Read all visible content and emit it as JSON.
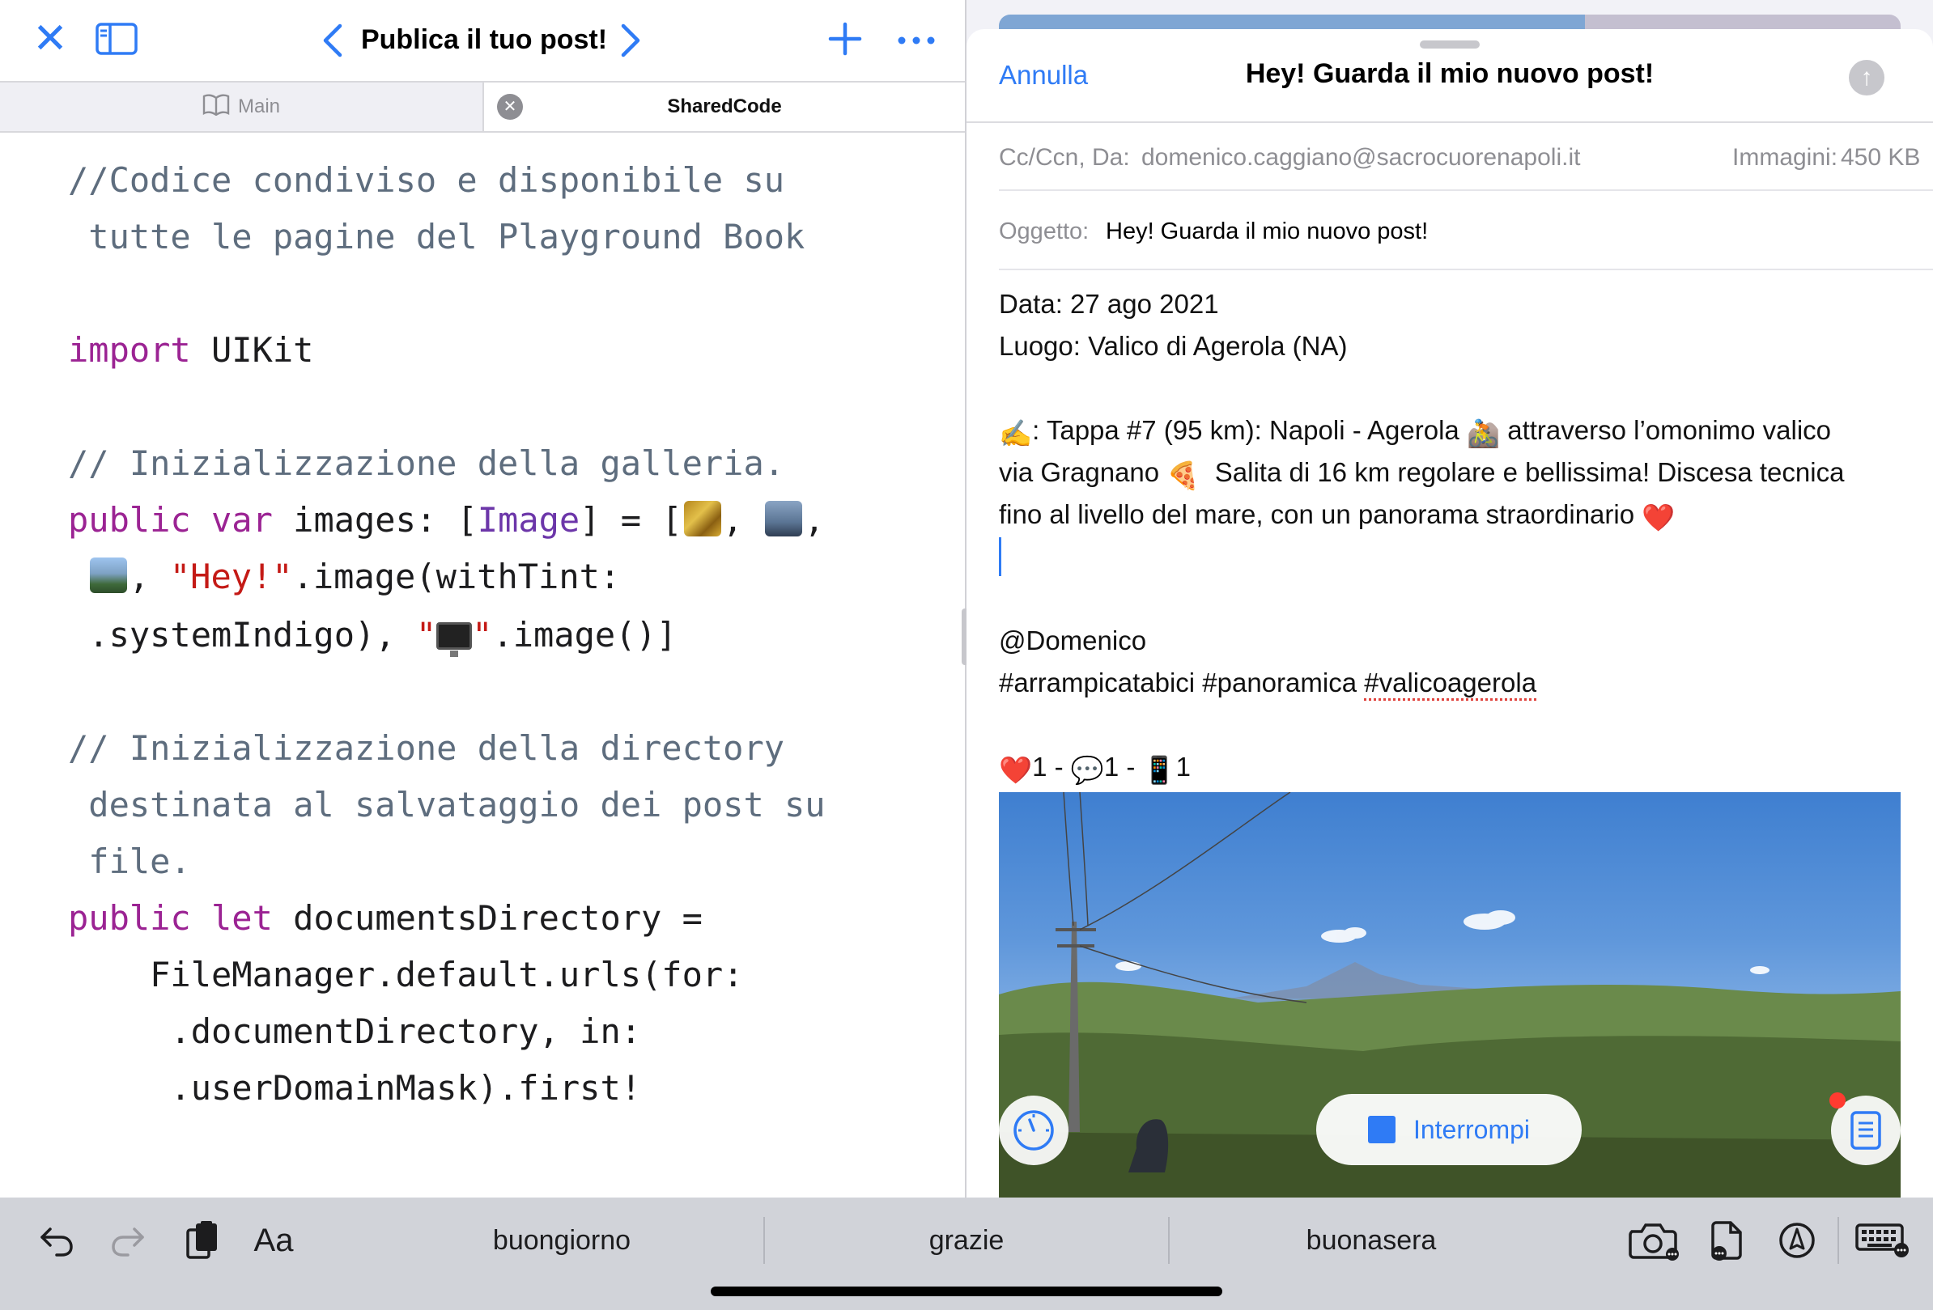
{
  "colors": {
    "accent": "#2f7bf5",
    "comment": "#5e6d7e",
    "keyword": "#9b2393",
    "type": "#6c36a9",
    "string": "#c41a16"
  },
  "playground": {
    "title": "Publica il tuo post!",
    "tabs": [
      {
        "label": "Main",
        "icon": "book-icon"
      },
      {
        "label": "SharedCode"
      }
    ],
    "code": {
      "l1": "//Codice condiviso e disponibile su",
      "l2": " tutte le pagine del Playground Book",
      "l3_kw": "import",
      "l3_rest": " UIKit",
      "l4": "// Inizializzazione della galleria.",
      "l5_kw1": "public",
      "l5_kw2": "var",
      "l5_a": " images: [",
      "l5_ty": "Image",
      "l5_b": "] = [",
      "l5_c": ", ",
      "l5_d": ",",
      "l6_a": ", ",
      "l6_str": "\"Hey!\"",
      "l6_b": ".image(withTint:",
      "l7_a": " .systemIndigo), ",
      "l7_q1": "\"",
      "l7_q2": "\"",
      "l7_b": ".image()]",
      "l8": "// Inizializzazione della directory",
      "l9": " destinata al salvataggio dei post su",
      "l10": " file.",
      "l11_kw1": "public",
      "l11_kw2": "let",
      "l11_rest": " documentsDirectory =",
      "l12": "    FileManager.default.urls(for:",
      "l13": "     .documentDirectory, in:",
      "l14": "     .userDomainMask).first!"
    }
  },
  "compose": {
    "cancel": "Annulla",
    "title": "Hey! Guarda il mio nuovo post!",
    "ccfrom_label": "Cc/Ccn, Da:",
    "from": "domenico.caggiano@sacrocuorenapoli.it",
    "images_label": "Immagini:",
    "images_size": "450 KB",
    "subject_label": "Oggetto:",
    "subject": "Hey! Guarda il mio nuovo post!",
    "body": {
      "date": "Data: 27 ago 2021",
      "place": "Luogo: Valico di Agerola (NA)",
      "writing_emoji": "✍️",
      "p1": ": Tappa #7 (95 km): Napoli - Agerola ",
      "bike_emoji": "🚵",
      "p1b": " attraverso l’omonimo valico",
      "p2a": "via Gragnano ",
      "pizza_emoji": "🍕",
      "p2b": "  Salita di 16 km regolare e bellissima! Discesa tecnica",
      "p3": "fino al livello del mare, con un panorama straordinario ",
      "heart_emoji": "❤️",
      "mention": "@Domenico",
      "tags_a": "#arrampicatabici #panoramica ",
      "tags_b": "#valicoagerola",
      "stats_heart": "❤️",
      "stats_1": "1 - ",
      "stats_bubble": "💬",
      "stats_2": "1 - ",
      "stats_phone": "📱",
      "stats_3": "1"
    },
    "stop_label": "Interrompi"
  },
  "shortcut_bar": {
    "format_label": "Aa",
    "suggestions": [
      "buongiorno",
      "grazie",
      "buonasera"
    ]
  }
}
